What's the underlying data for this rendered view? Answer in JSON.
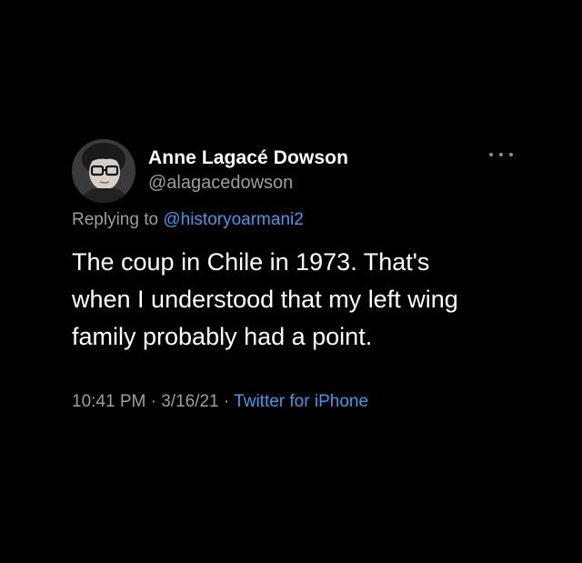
{
  "tweet": {
    "author": {
      "display_name": "Anne Lagacé Dowson",
      "handle": "@alagacedowson",
      "avatar_icon": "user-avatar"
    },
    "more_icon": "more-horizontal-icon",
    "reply": {
      "prefix": "Replying to ",
      "to_handle": "@historyoarmani2"
    },
    "text_lines": [
      "The coup in Chile in 1973. That's",
      "when I understood that my left wing",
      "family probably had a point."
    ],
    "time": "10:41 PM",
    "separator": " · ",
    "date": "3/16/21",
    "source": "Twitter for iPhone",
    "colors": {
      "background": "#000000",
      "text": "#ffffff",
      "muted": "#9a9ea3",
      "link": "#3d9be9"
    }
  }
}
